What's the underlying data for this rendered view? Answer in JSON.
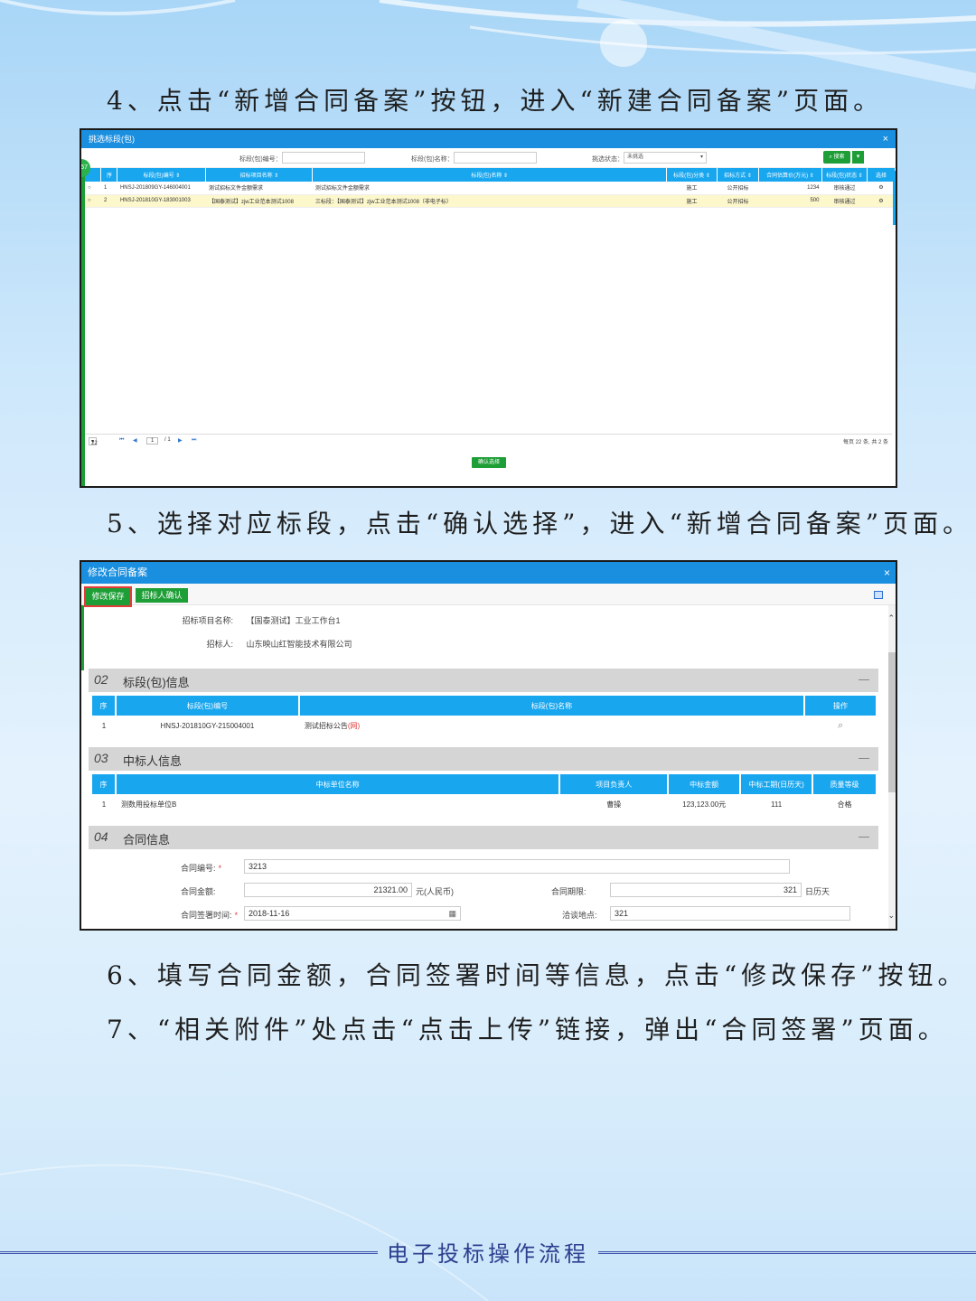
{
  "steps": {
    "s4": "4、点击“新增合同备案”按钮，进入“新建合同备案”页面。",
    "s5": "5、选择对应标段，点击“确认选择”，进入“新增合同备案”页面。",
    "s6": "6、填写合同金额，合同签署时间等信息，点击“修改保存”按钮。",
    "s7": "7、“相关附件”处点击“点击上传”链接，弹出“合同签署”页面。"
  },
  "shot1": {
    "title": "挑选标段(包)",
    "badge": "57",
    "filters": {
      "code_label": "标段(包)编号：",
      "name_label": "标段(包)名称：",
      "status_label": "挑选状态：",
      "status_value": "未挑选",
      "search": "搜索"
    },
    "columns": [
      "序",
      "标段(包)编号 ⇕",
      "招标项目名称 ⇕",
      "标段(包)名称 ⇕",
      "标段(包)分类 ⇕",
      "招标方式 ⇕",
      "合同估算价(万元) ⇕",
      "标段(包)状态 ⇕",
      "选择"
    ],
    "rows": [
      [
        "1",
        "HNSJ-201809GY-146004001",
        "测试招标文件金额需求",
        "测试招标文件金额需求",
        "施工",
        "公开招标",
        "1234",
        "审核通过"
      ],
      [
        "2",
        "HNSJ-201810GY-183001003",
        "【国泰测试】zjw工业范本测试1008",
        "三标段：【国泰测试】zjw工业范本测试1008（非电子标）",
        "施工",
        "公开招标",
        "500",
        "审核通过"
      ]
    ],
    "pager": {
      "size": "22",
      "page": "1",
      "total_pages": "/ 1",
      "summary": "每页 22 条, 共 2 条"
    },
    "confirm": "确认选择"
  },
  "shot2": {
    "title": "修改合同备案",
    "save": "修改保存",
    "confirm": "招标人确认",
    "project_label": "招标项目名称:",
    "project_value": "【国泰测试】工业工作台1",
    "tenderer_label": "招标人:",
    "tenderer_value": "山东映山红智能技术有限公司",
    "sec2": {
      "no": "02",
      "title": "标段(包)信息"
    },
    "sec2_cols": [
      "序",
      "标段(包)编号",
      "标段(包)名称",
      "操作"
    ],
    "sec2_row": {
      "no": "1",
      "code": "HNSJ-201810GY-215004001",
      "name": "测试招标公告",
      "tag": "(网)"
    },
    "sec3": {
      "no": "03",
      "title": "中标人信息"
    },
    "sec3_cols": [
      "序",
      "中标单位名称",
      "项目负责人",
      "中标金额",
      "中标工期(日历天)",
      "质量等级"
    ],
    "sec3_row": [
      "1",
      "测数用投标单位B",
      "曹操",
      "123,123.00元",
      "111",
      "合格"
    ],
    "sec4": {
      "no": "04",
      "title": "合同信息"
    },
    "contract_no_label": "合同编号:",
    "contract_no": "3213",
    "amount_label": "合同金额:",
    "amount": "21321.00",
    "amount_unit": "元(人民币)",
    "term_label": "合同期限:",
    "term": "321",
    "term_unit": "日历天",
    "sign_label": "合同签署时间:",
    "sign_date": "2018-11-16",
    "place_label": "洽谈地点:",
    "place": "321"
  },
  "footer": "电子投标操作流程",
  "colors": {
    "blue": "#18a6ef",
    "green": "#1e9e36",
    "red": "#e53b3b",
    "footer": "#2d3f8e"
  }
}
